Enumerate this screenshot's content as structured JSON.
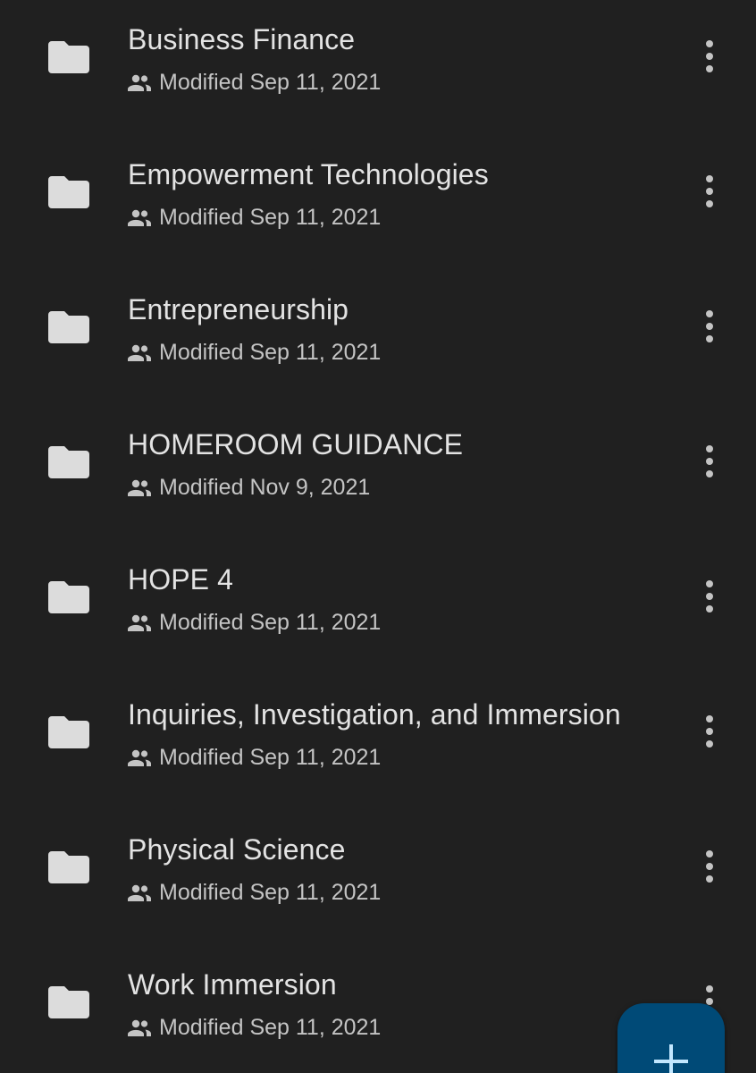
{
  "folders": [
    {
      "title": "Business Finance",
      "modified": "Modified Sep 11, 2021",
      "icon": "folder-icon",
      "shared_icon": "shared-icon",
      "more_icon": "more-vert-icon"
    },
    {
      "title": "Empowerment Technologies",
      "modified": "Modified Sep 11, 2021",
      "icon": "folder-icon",
      "shared_icon": "shared-icon",
      "more_icon": "more-vert-icon"
    },
    {
      "title": "Entrepreneurship",
      "modified": "Modified Sep 11, 2021",
      "icon": "folder-icon",
      "shared_icon": "shared-icon",
      "more_icon": "more-vert-icon"
    },
    {
      "title": "HOMEROOM GUIDANCE",
      "modified": "Modified Nov 9, 2021",
      "icon": "folder-icon",
      "shared_icon": "shared-icon",
      "more_icon": "more-vert-icon"
    },
    {
      "title": "HOPE 4",
      "modified": "Modified Sep 11, 2021",
      "icon": "folder-icon",
      "shared_icon": "shared-icon",
      "more_icon": "more-vert-icon"
    },
    {
      "title": "Inquiries, Investigation, and Immersion",
      "modified": "Modified Sep 11, 2021",
      "icon": "folder-icon",
      "shared_icon": "shared-icon",
      "more_icon": "more-vert-icon"
    },
    {
      "title": "Physical Science",
      "modified": "Modified Sep 11, 2021",
      "icon": "folder-icon",
      "shared_icon": "shared-icon",
      "more_icon": "more-vert-icon"
    },
    {
      "title": "Work Immersion",
      "modified": "Modified Sep 11, 2021",
      "icon": "folder-icon",
      "shared_icon": "shared-icon",
      "more_icon": "more-vert-icon"
    }
  ],
  "fab": {
    "icon": "plus-icon"
  },
  "colors": {
    "background": "#202020",
    "title_text": "#e3e3e3",
    "meta_text": "#c4c4c4",
    "folder_icon": "#dcdcdc",
    "fab_background": "#004a77",
    "fab_icon": "#c2e7ff"
  }
}
